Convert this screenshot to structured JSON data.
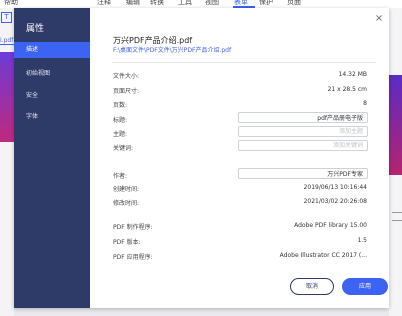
{
  "background": {
    "menu": [
      "帮助",
      "注释",
      "编辑",
      "转换",
      "工具",
      "视图",
      "表单",
      "保护",
      "页面"
    ],
    "active_menu_index": 6,
    "toolbox_glyph": "T",
    "tab_label": "i.pdf"
  },
  "dialog": {
    "title": "属性",
    "close_glyph": "×",
    "nav": [
      "描述",
      "初始视图",
      "安全",
      "字体"
    ],
    "active_nav_index": 0,
    "doc_name": "万兴PDF产品介绍.pdf",
    "doc_path": "F:\\桌面文件\\PDF文件\\万兴PDF产品介绍.pdf",
    "props": {
      "file_size_label": "文件大小:",
      "file_size": "14.32 MB",
      "page_size_label": "页面尺寸:",
      "page_size": "21 x 28.5 cm",
      "pages_label": "页数:",
      "pages": "8",
      "title_label": "标题:",
      "title_value": "pdf产品册电子版",
      "subject_label": "主题:",
      "subject_placeholder": "添加主题",
      "keywords_label": "关键词:",
      "keywords_placeholder": "添加关键词",
      "author_label": "作者:",
      "author_value": "万兴PDF专家",
      "created_label": "创建时间:",
      "created": "2019/06/13 10:16:44",
      "modified_label": "修改时间:",
      "modified": "2021/03/02 20:26:08",
      "producer_label": "PDF 制作程序:",
      "producer": "Adobe PDF library 15.00",
      "version_label": "PDF 版本:",
      "version": "1.5",
      "application_label": "PDF 应用程序:",
      "application": "Adobe Illustrator CC 2017 (..."
    },
    "cancel_label": "取消",
    "apply_label": "应用"
  }
}
